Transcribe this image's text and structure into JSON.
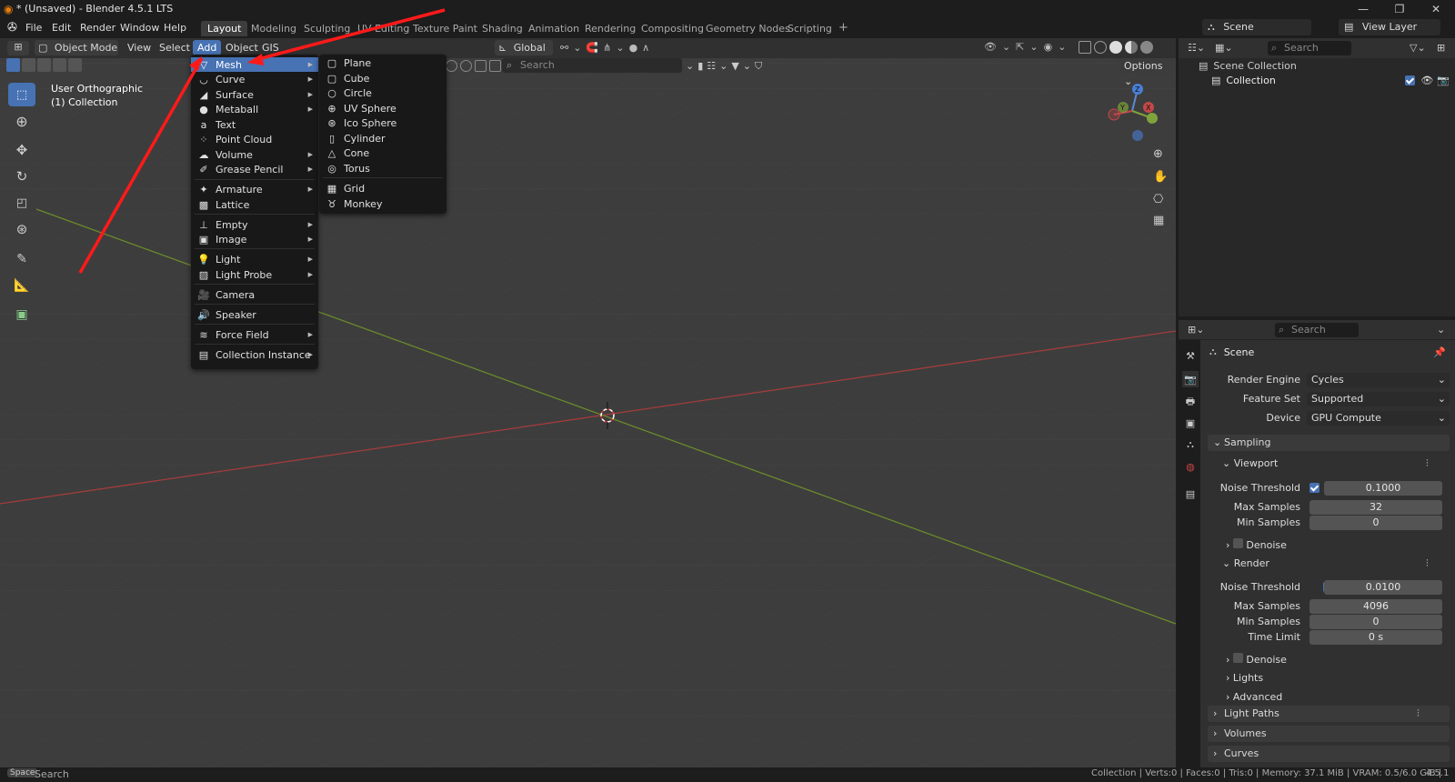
{
  "titlebar": {
    "title": "* (Unsaved) - Blender 4.5.1 LTS",
    "min": "—",
    "max": "❐",
    "close": "✕"
  },
  "menubar": {
    "items": [
      "File",
      "Edit",
      "Render",
      "Window",
      "Help"
    ]
  },
  "workspaces": [
    "Layout",
    "Modeling",
    "Sculpting",
    "UV Editing",
    "Texture Paint",
    "Shading",
    "Animation",
    "Rendering",
    "Compositing",
    "Geometry Nodes",
    "Scripting"
  ],
  "add_workspace": "+",
  "scene": {
    "label": "Scene",
    "view_layer": "View Layer"
  },
  "viewport": {
    "mode": "Object Mode",
    "menus": [
      "View",
      "Select",
      "Add",
      "Object",
      "GIS"
    ],
    "transform_orientation": "Global",
    "view_name": "User Orthographic",
    "collection_info": "(1) Collection",
    "options_label": "Options",
    "search_placeholder": "Search"
  },
  "add_menu": {
    "items": [
      {
        "label": "Mesh",
        "sub": true,
        "icon": "mesh-icon"
      },
      {
        "label": "Curve",
        "sub": true,
        "icon": "curve-icon"
      },
      {
        "label": "Surface",
        "sub": true,
        "icon": "surface-icon"
      },
      {
        "label": "Metaball",
        "sub": true,
        "icon": "metaball-icon"
      },
      {
        "label": "Text",
        "sub": false,
        "icon": "text-icon"
      },
      {
        "label": "Point Cloud",
        "sub": false,
        "icon": "point-cloud-icon"
      },
      {
        "label": "Volume",
        "sub": true,
        "icon": "volume-icon"
      },
      {
        "label": "Grease Pencil",
        "sub": true,
        "icon": "grease-pencil-icon"
      },
      {
        "label": "Armature",
        "sub": true,
        "icon": "armature-icon"
      },
      {
        "label": "Lattice",
        "sub": false,
        "icon": "lattice-icon"
      },
      {
        "label": "Empty",
        "sub": true,
        "icon": "empty-icon"
      },
      {
        "label": "Image",
        "sub": true,
        "icon": "image-icon"
      },
      {
        "label": "Light",
        "sub": true,
        "icon": "light-icon"
      },
      {
        "label": "Light Probe",
        "sub": true,
        "icon": "light-probe-icon"
      },
      {
        "label": "Camera",
        "sub": false,
        "icon": "camera-icon"
      },
      {
        "label": "Speaker",
        "sub": false,
        "icon": "speaker-icon"
      },
      {
        "label": "Force Field",
        "sub": true,
        "icon": "force-field-icon"
      },
      {
        "label": "Collection Instance",
        "sub": true,
        "icon": "collection-instance-icon"
      }
    ]
  },
  "mesh_menu": {
    "items": [
      {
        "label": "Plane",
        "icon": "plane-icon"
      },
      {
        "label": "Cube",
        "icon": "cube-icon"
      },
      {
        "label": "Circle",
        "icon": "circle-icon"
      },
      {
        "label": "UV Sphere",
        "icon": "uv-sphere-icon"
      },
      {
        "label": "Ico Sphere",
        "icon": "ico-sphere-icon"
      },
      {
        "label": "Cylinder",
        "icon": "cylinder-icon"
      },
      {
        "label": "Cone",
        "icon": "cone-icon"
      },
      {
        "label": "Torus",
        "icon": "torus-icon"
      },
      {
        "label": "Grid",
        "icon": "grid-icon"
      },
      {
        "label": "Monkey",
        "icon": "monkey-icon"
      }
    ]
  },
  "gizmo": {
    "z": "Z",
    "y": "Y",
    "x": "X"
  },
  "outliner": {
    "search_placeholder": "Search",
    "scene_collection": "Scene Collection",
    "collection": "Collection"
  },
  "properties": {
    "search_placeholder": "Search",
    "context": "Scene",
    "render_engine_label": "Render Engine",
    "render_engine": "Cycles",
    "feature_set_label": "Feature Set",
    "feature_set": "Supported",
    "device_label": "Device",
    "device": "GPU Compute",
    "sampling": "Sampling",
    "viewport": "Viewport",
    "noise_threshold_label": "Noise Threshold",
    "vp_noise_threshold": "0.1000",
    "max_samples_label": "Max Samples",
    "vp_max_samples": "32",
    "min_samples_label": "Min Samples",
    "vp_min_samples": "0",
    "denoise": "Denoise",
    "render": "Render",
    "r_noise_threshold": "0.0100",
    "r_max_samples": "4096",
    "r_min_samples": "0",
    "time_limit_label": "Time Limit",
    "time_limit": "0 s",
    "lights": "Lights",
    "advanced": "Advanced",
    "light_paths": "Light Paths",
    "volumes": "Volumes",
    "curves": "Curves"
  },
  "statusbar": {
    "key": "Space",
    "action": "Search",
    "stats": "Collection | Verts:0 | Faces:0 | Tris:0 | Memory: 37.1 MiB | VRAM: 0.5/6.0 GiB |",
    "version": "4.5.1"
  },
  "colors": {
    "accent": "#4772b3",
    "x_axis": "#c44848",
    "y_axis": "#7a9a2e",
    "annotation": "#ff1a1a"
  }
}
